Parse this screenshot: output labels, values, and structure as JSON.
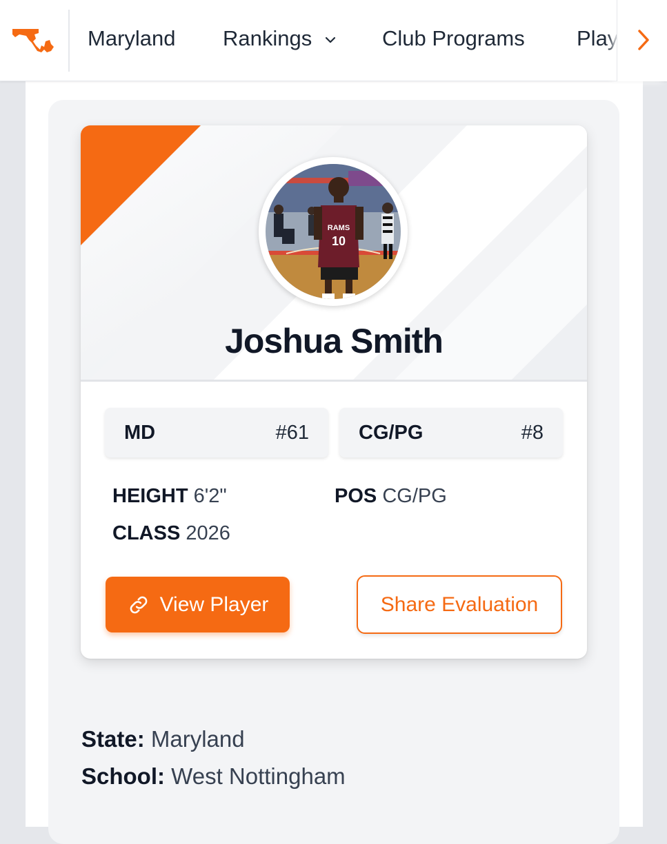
{
  "nav": {
    "items": [
      {
        "label": "Maryland"
      },
      {
        "label": "Rankings"
      },
      {
        "label": "Club Programs"
      },
      {
        "label": "Play"
      }
    ]
  },
  "player": {
    "name": "Joshua Smith",
    "jersey_text": "RAMS",
    "jersey_number": "10",
    "state_rank": {
      "label": "MD",
      "value": "#61"
    },
    "position_rank": {
      "label": "CG/PG",
      "value": "#8"
    },
    "attributes": {
      "height_label": "HEIGHT",
      "height_value": "6'2\"",
      "pos_label": "POS",
      "pos_value": "CG/PG",
      "class_label": "CLASS",
      "class_value": "2026"
    },
    "buttons": {
      "view": "View Player",
      "share": "Share Evaluation"
    }
  },
  "details": {
    "state_label": "State:",
    "state_value": "Maryland",
    "school_label": "School:",
    "school_value": "West Nottingham"
  },
  "colors": {
    "accent": "#f56a13",
    "text": "#111827",
    "muted": "#374151"
  },
  "icons": {
    "logo": "maryland-state-icon",
    "rankings_chevron": "chevron-down-icon",
    "scroll": "chevron-right-icon",
    "view_player": "link-icon"
  }
}
